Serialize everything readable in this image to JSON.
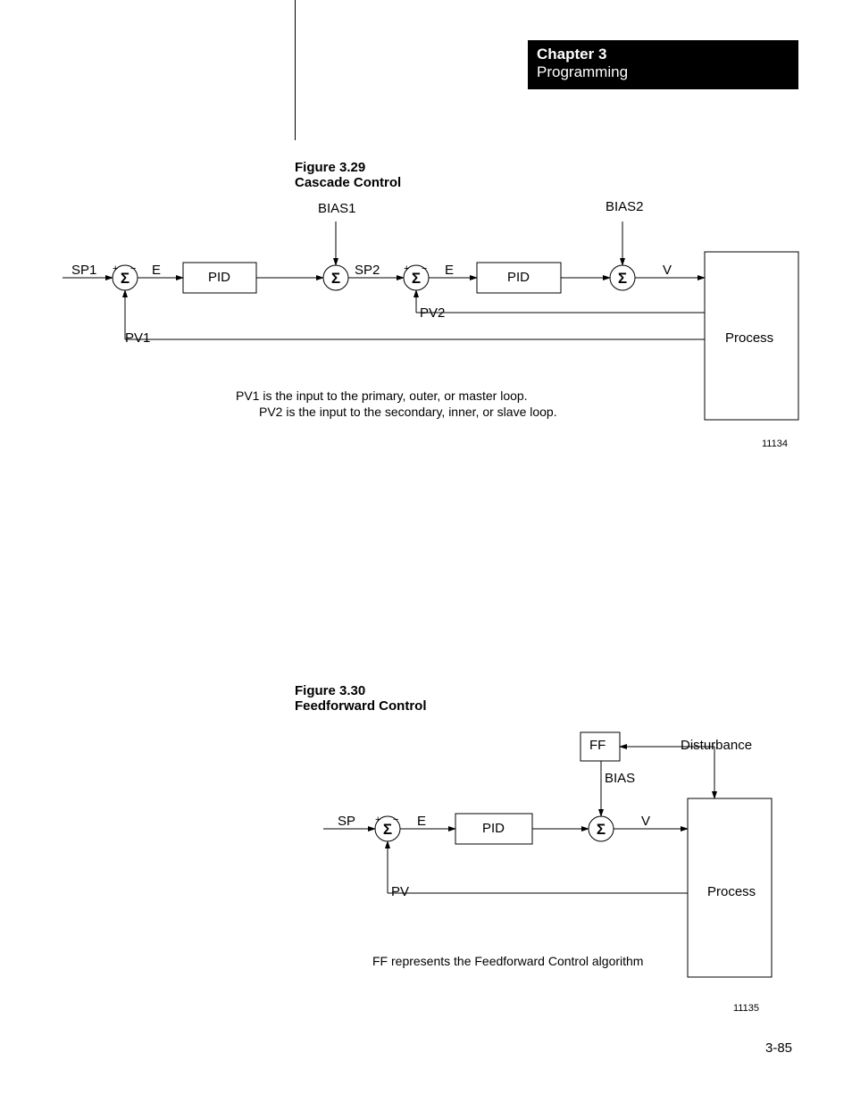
{
  "header": {
    "chapter": "Chapter 3",
    "section": "Programming"
  },
  "figure1": {
    "number": "Figure 3.29",
    "title": "Cascade Control",
    "labels": {
      "bias1": "BIAS1",
      "bias2": "BIAS2",
      "sp1": "SP1",
      "e1": "E",
      "pid1": "PID",
      "sp2": "SP2",
      "e2": "E",
      "pid2": "PID",
      "v": "V",
      "process": "Process",
      "pv1": "PV1",
      "pv2": "PV2"
    },
    "notes_line1": "PV1 is the input to the primary, outer, or master loop.",
    "notes_line2": "PV2 is the input to the secondary, inner, or slave loop.",
    "image_id": "11134"
  },
  "figure2": {
    "number": "Figure 3.30",
    "title": "Feedforward Control",
    "labels": {
      "ff": "FF",
      "disturbance": "Disturbance",
      "bias": "BIAS",
      "sp": "SP",
      "e": "E",
      "pid": "PID",
      "v": "V",
      "process": "Process",
      "pv": "PV"
    },
    "notes_line1": "FF represents the Feedforward Control algorithm",
    "image_id": "11135"
  },
  "page_number": "3-85"
}
